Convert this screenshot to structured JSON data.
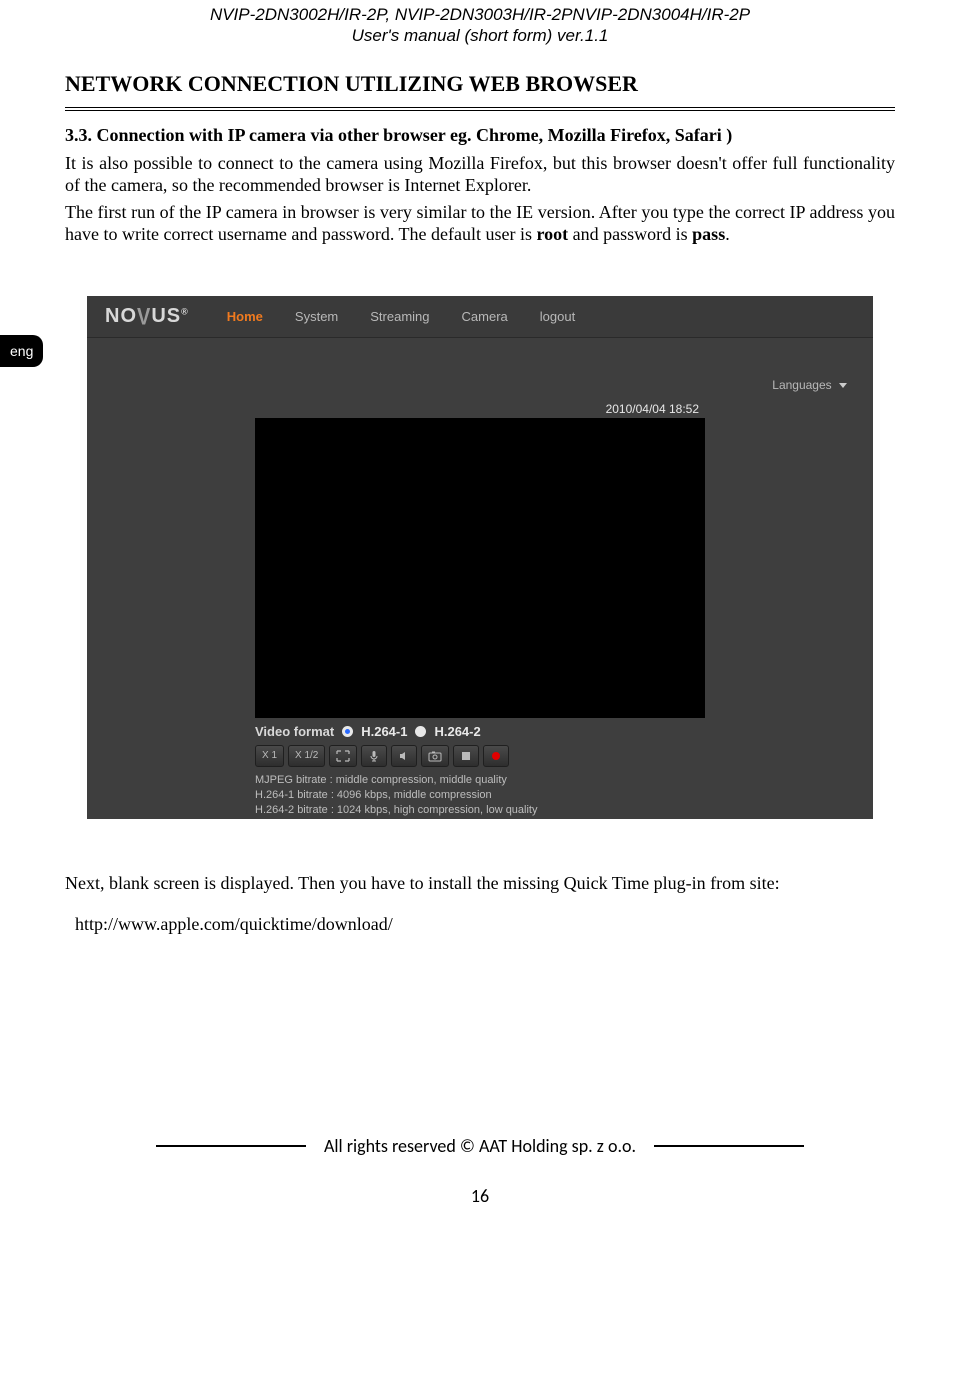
{
  "header": {
    "models": "NVIP-2DN3002H/IR-2P, NVIP-2DN3003H/IR-2PNVIP-2DN3004H/IR-2P",
    "manual": "User's manual (short form) ver.1.1"
  },
  "langTab": "eng",
  "title": "NETWORK CONNECTION UTILIZING WEB BROWSER",
  "section": {
    "heading": "3.3. Connection with IP camera via other browser eg. Chrome, Mozilla Firefox, Safari )",
    "p1a": "It is also possible to connect to the camera using Mozilla Firefox, but this browser doesn't offer full functionality of the camera, so the recommended browser is Internet Explorer.",
    "p2a": "The first run of the IP camera in browser is very similar to  the IE version. After you type the correct IP address you have to write correct username and password. The default user is ",
    "p2user": "root",
    "p2b": " and password is ",
    "p2pass": "pass",
    "p2c": "."
  },
  "screenshot": {
    "logo": {
      "pre": "N",
      "o1": "O",
      "v": "V",
      "post": "US",
      "reg": "®"
    },
    "nav": {
      "home": "Home",
      "system": "System",
      "streaming": "Streaming",
      "camera": "Camera",
      "logout": "logout"
    },
    "languages": "Languages",
    "timestamp": "2010/04/04 18:52",
    "vf": {
      "label": "Video format",
      "opt1": "H.264-1",
      "opt2": "H.264-2"
    },
    "controls": {
      "x1": "X 1",
      "x12": "X 1/2"
    },
    "info": {
      "l1": "MJPEG bitrate : middle compression, middle quality",
      "l2": "H.264-1 bitrate : 4096 kbps, middle compression",
      "l3": "H.264-2 bitrate : 1024 kbps, high compression, low quality"
    }
  },
  "after": {
    "p": "Next, blank screen is displayed. Then you have to install the missing Quick Time plug-in from site:",
    "url": "http://www.apple.com/quicktime/download/"
  },
  "footer": {
    "copyright": "All rights reserved © AAT Holding sp. z o.o.",
    "page": "16"
  }
}
